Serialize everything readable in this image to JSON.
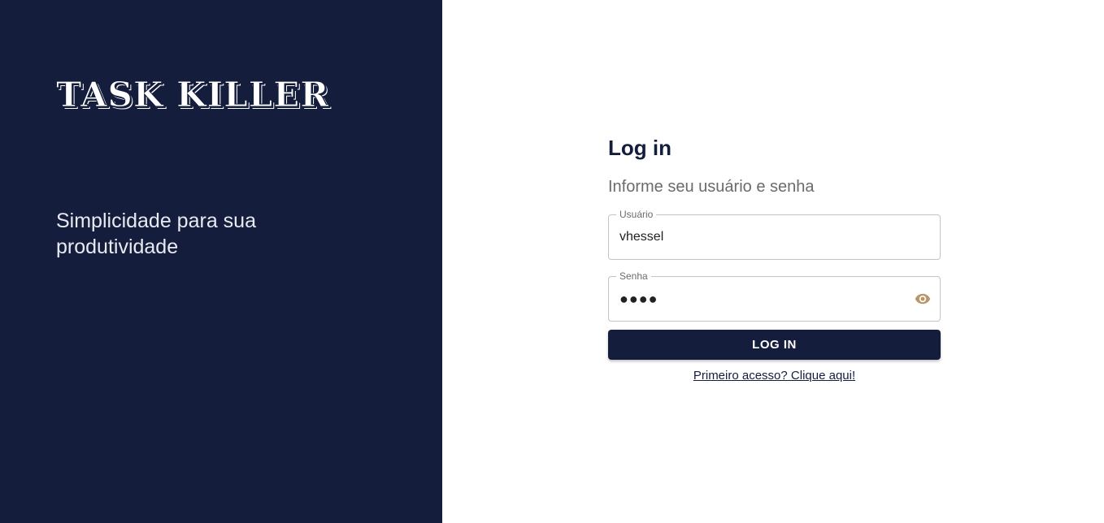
{
  "brand": {
    "logo_text": "TASK KILLER",
    "tagline": "Simplicidade para sua produtividade"
  },
  "login": {
    "title": "Log in",
    "subtitle": "Informe seu usuário e senha",
    "username": {
      "label": "Usuário",
      "value": "vhessel"
    },
    "password": {
      "label": "Senha",
      "masked_value": "●●●●"
    },
    "button_label": "LOG IN",
    "first_access_link": "Primeiro acesso? Clique aqui!"
  },
  "icons": {
    "password_toggle": "eye-icon"
  },
  "colors": {
    "panel": "#141d3b",
    "accent": "#b8956a"
  }
}
